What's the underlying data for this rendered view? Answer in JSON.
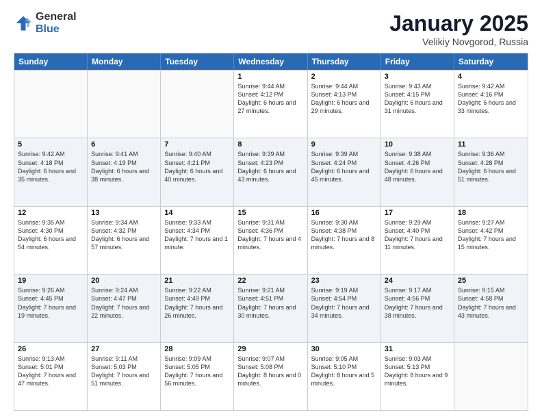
{
  "logo": {
    "general": "General",
    "blue": "Blue"
  },
  "title": "January 2025",
  "location": "Velikiy Novgorod, Russia",
  "days_of_week": [
    "Sunday",
    "Monday",
    "Tuesday",
    "Wednesday",
    "Thursday",
    "Friday",
    "Saturday"
  ],
  "weeks": [
    [
      {
        "day": "",
        "info": "",
        "empty": true
      },
      {
        "day": "",
        "info": "",
        "empty": true
      },
      {
        "day": "",
        "info": "",
        "empty": true
      },
      {
        "day": "1",
        "info": "Sunrise: 9:44 AM\nSunset: 4:12 PM\nDaylight: 6 hours and 27 minutes."
      },
      {
        "day": "2",
        "info": "Sunrise: 9:44 AM\nSunset: 4:13 PM\nDaylight: 6 hours and 29 minutes."
      },
      {
        "day": "3",
        "info": "Sunrise: 9:43 AM\nSunset: 4:15 PM\nDaylight: 6 hours and 31 minutes."
      },
      {
        "day": "4",
        "info": "Sunrise: 9:42 AM\nSunset: 4:16 PM\nDaylight: 6 hours and 33 minutes."
      }
    ],
    [
      {
        "day": "5",
        "info": "Sunrise: 9:42 AM\nSunset: 4:18 PM\nDaylight: 6 hours and 35 minutes."
      },
      {
        "day": "6",
        "info": "Sunrise: 9:41 AM\nSunset: 4:19 PM\nDaylight: 6 hours and 38 minutes."
      },
      {
        "day": "7",
        "info": "Sunrise: 9:40 AM\nSunset: 4:21 PM\nDaylight: 6 hours and 40 minutes."
      },
      {
        "day": "8",
        "info": "Sunrise: 9:39 AM\nSunset: 4:23 PM\nDaylight: 6 hours and 43 minutes."
      },
      {
        "day": "9",
        "info": "Sunrise: 9:39 AM\nSunset: 4:24 PM\nDaylight: 6 hours and 45 minutes."
      },
      {
        "day": "10",
        "info": "Sunrise: 9:38 AM\nSunset: 4:26 PM\nDaylight: 6 hours and 48 minutes."
      },
      {
        "day": "11",
        "info": "Sunrise: 9:36 AM\nSunset: 4:28 PM\nDaylight: 6 hours and 51 minutes."
      }
    ],
    [
      {
        "day": "12",
        "info": "Sunrise: 9:35 AM\nSunset: 4:30 PM\nDaylight: 6 hours and 54 minutes."
      },
      {
        "day": "13",
        "info": "Sunrise: 9:34 AM\nSunset: 4:32 PM\nDaylight: 6 hours and 57 minutes."
      },
      {
        "day": "14",
        "info": "Sunrise: 9:33 AM\nSunset: 4:34 PM\nDaylight: 7 hours and 1 minute."
      },
      {
        "day": "15",
        "info": "Sunrise: 9:31 AM\nSunset: 4:36 PM\nDaylight: 7 hours and 4 minutes."
      },
      {
        "day": "16",
        "info": "Sunrise: 9:30 AM\nSunset: 4:38 PM\nDaylight: 7 hours and 8 minutes."
      },
      {
        "day": "17",
        "info": "Sunrise: 9:29 AM\nSunset: 4:40 PM\nDaylight: 7 hours and 11 minutes."
      },
      {
        "day": "18",
        "info": "Sunrise: 9:27 AM\nSunset: 4:42 PM\nDaylight: 7 hours and 15 minutes."
      }
    ],
    [
      {
        "day": "19",
        "info": "Sunrise: 9:26 AM\nSunset: 4:45 PM\nDaylight: 7 hours and 19 minutes."
      },
      {
        "day": "20",
        "info": "Sunrise: 9:24 AM\nSunset: 4:47 PM\nDaylight: 7 hours and 22 minutes."
      },
      {
        "day": "21",
        "info": "Sunrise: 9:22 AM\nSunset: 4:49 PM\nDaylight: 7 hours and 26 minutes."
      },
      {
        "day": "22",
        "info": "Sunrise: 9:21 AM\nSunset: 4:51 PM\nDaylight: 7 hours and 30 minutes."
      },
      {
        "day": "23",
        "info": "Sunrise: 9:19 AM\nSunset: 4:54 PM\nDaylight: 7 hours and 34 minutes."
      },
      {
        "day": "24",
        "info": "Sunrise: 9:17 AM\nSunset: 4:56 PM\nDaylight: 7 hours and 38 minutes."
      },
      {
        "day": "25",
        "info": "Sunrise: 9:15 AM\nSunset: 4:58 PM\nDaylight: 7 hours and 43 minutes."
      }
    ],
    [
      {
        "day": "26",
        "info": "Sunrise: 9:13 AM\nSunset: 5:01 PM\nDaylight: 7 hours and 47 minutes."
      },
      {
        "day": "27",
        "info": "Sunrise: 9:11 AM\nSunset: 5:03 PM\nDaylight: 7 hours and 51 minutes."
      },
      {
        "day": "28",
        "info": "Sunrise: 9:09 AM\nSunset: 5:05 PM\nDaylight: 7 hours and 56 minutes."
      },
      {
        "day": "29",
        "info": "Sunrise: 9:07 AM\nSunset: 5:08 PM\nDaylight: 8 hours and 0 minutes."
      },
      {
        "day": "30",
        "info": "Sunrise: 9:05 AM\nSunset: 5:10 PM\nDaylight: 8 hours and 5 minutes."
      },
      {
        "day": "31",
        "info": "Sunrise: 9:03 AM\nSunset: 5:13 PM\nDaylight: 8 hours and 9 minutes."
      },
      {
        "day": "",
        "info": "",
        "empty": true
      }
    ]
  ]
}
